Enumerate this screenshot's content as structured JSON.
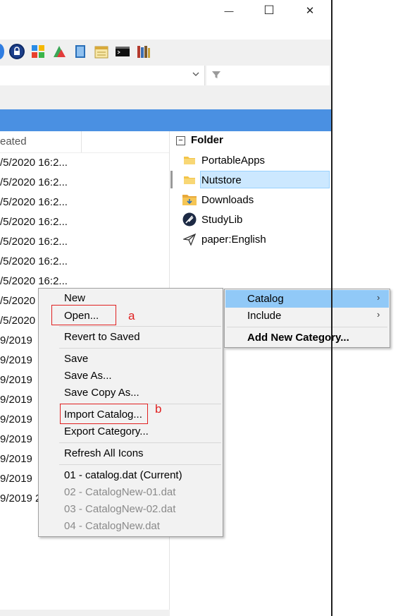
{
  "window": {
    "caption_buttons": [
      {
        "name": "minimize",
        "glyph": "—"
      },
      {
        "name": "maximize",
        "glyph": "☐"
      },
      {
        "name": "close",
        "glyph": "✕"
      }
    ]
  },
  "toolbar": {
    "icons": [
      "globe-icon",
      "lock-icon",
      "colorful-grid-icon",
      "paint-icon",
      "book-icon",
      "calendar-icon",
      "terminal-icon",
      "books-icon"
    ]
  },
  "list": {
    "column_created": "eated",
    "rows": [
      "/5/2020 16:2...",
      "/5/2020 16:2...",
      "/5/2020 16:2...",
      "/5/2020 16:2...",
      "/5/2020 16:2...",
      "/5/2020 16:2...",
      "/5/2020 16:2...",
      "/5/2020",
      "/5/2020",
      "9/2019",
      "9/2019",
      "9/2019",
      "9/2019",
      "9/2019",
      "9/2019",
      "9/2019",
      "9/2019",
      "9/2019 2"
    ]
  },
  "tree": {
    "header": "Folder",
    "collapse_glyph": "−",
    "items": [
      {
        "label": "PortableApps",
        "icon": "folder-icon"
      },
      {
        "label": "Nutstore",
        "icon": "folder-icon"
      },
      {
        "label": "Downloads",
        "icon": "downloads-folder-icon"
      },
      {
        "label": "StudyLib",
        "icon": "quill-icon"
      },
      {
        "label": "paper:English",
        "icon": "paper-plane-icon"
      }
    ]
  },
  "context_menu": {
    "items": [
      {
        "label": "New",
        "enabled": true
      },
      {
        "label": "Open...",
        "enabled": true
      },
      {
        "label": "Revert to Saved",
        "enabled": true
      },
      {
        "label": "Save",
        "enabled": true
      },
      {
        "label": "Save As...",
        "enabled": true
      },
      {
        "label": "Save Copy As...",
        "enabled": true
      },
      {
        "label": "Import Catalog...",
        "enabled": true
      },
      {
        "label": "Export Category...",
        "enabled": true
      },
      {
        "label": "Refresh All Icons",
        "enabled": true
      },
      {
        "label": "01 - catalog.dat (Current)",
        "enabled": true
      },
      {
        "label": "02 - CatalogNew-01.dat",
        "enabled": false
      },
      {
        "label": "03 - CatalogNew-02.dat",
        "enabled": false
      },
      {
        "label": "04 - CatalogNew.dat",
        "enabled": false
      }
    ],
    "annotations": [
      {
        "label": "a"
      },
      {
        "label": "b"
      }
    ]
  },
  "submenu": {
    "items": [
      {
        "label": "Catalog",
        "has_submenu": true
      },
      {
        "label": "Include",
        "has_submenu": true
      },
      {
        "label": "Add New Category...",
        "bold": true
      }
    ],
    "chevron": "›"
  },
  "colors": {
    "selection_bar": "#4a90e2",
    "submenu_highlight": "#91c9f7",
    "annotation_red": "#e02020"
  }
}
